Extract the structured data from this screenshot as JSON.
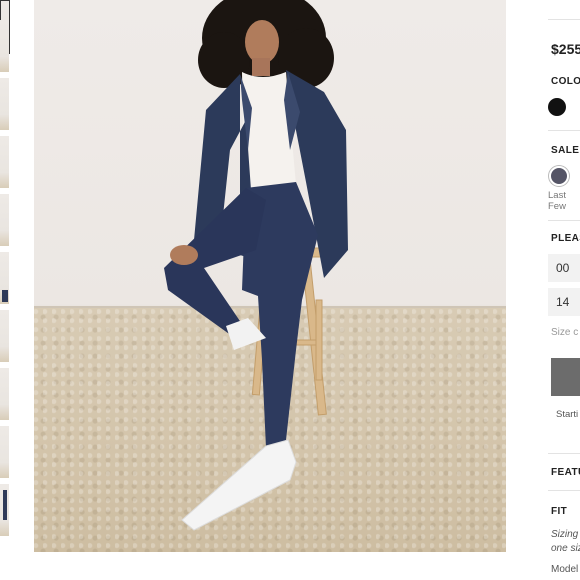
{
  "thumbnails": {
    "count": 10,
    "active_index": 0
  },
  "hero_image": {
    "alt": "Model wearing denim jacket, white tee and navy pants seated on wooden stool"
  },
  "product": {
    "price": "$255",
    "color_label": "COLOR",
    "sale_label": "SALE",
    "sale_swatch_note": "Last Few",
    "please_label": "PLEAS",
    "size_options": [
      "00",
      "14"
    ],
    "size_chart_link": "Size c",
    "add_button_label": "",
    "starting_note": "Starti",
    "features_label": "FEATU",
    "fit_label": "FIT",
    "fit_note_line1": "Sizing",
    "fit_note_line2": "one siz",
    "model_note": "Model"
  },
  "colors": {
    "swatch_black": "#111111",
    "swatch_sale": "#555566",
    "button": "#6c6c6c"
  }
}
